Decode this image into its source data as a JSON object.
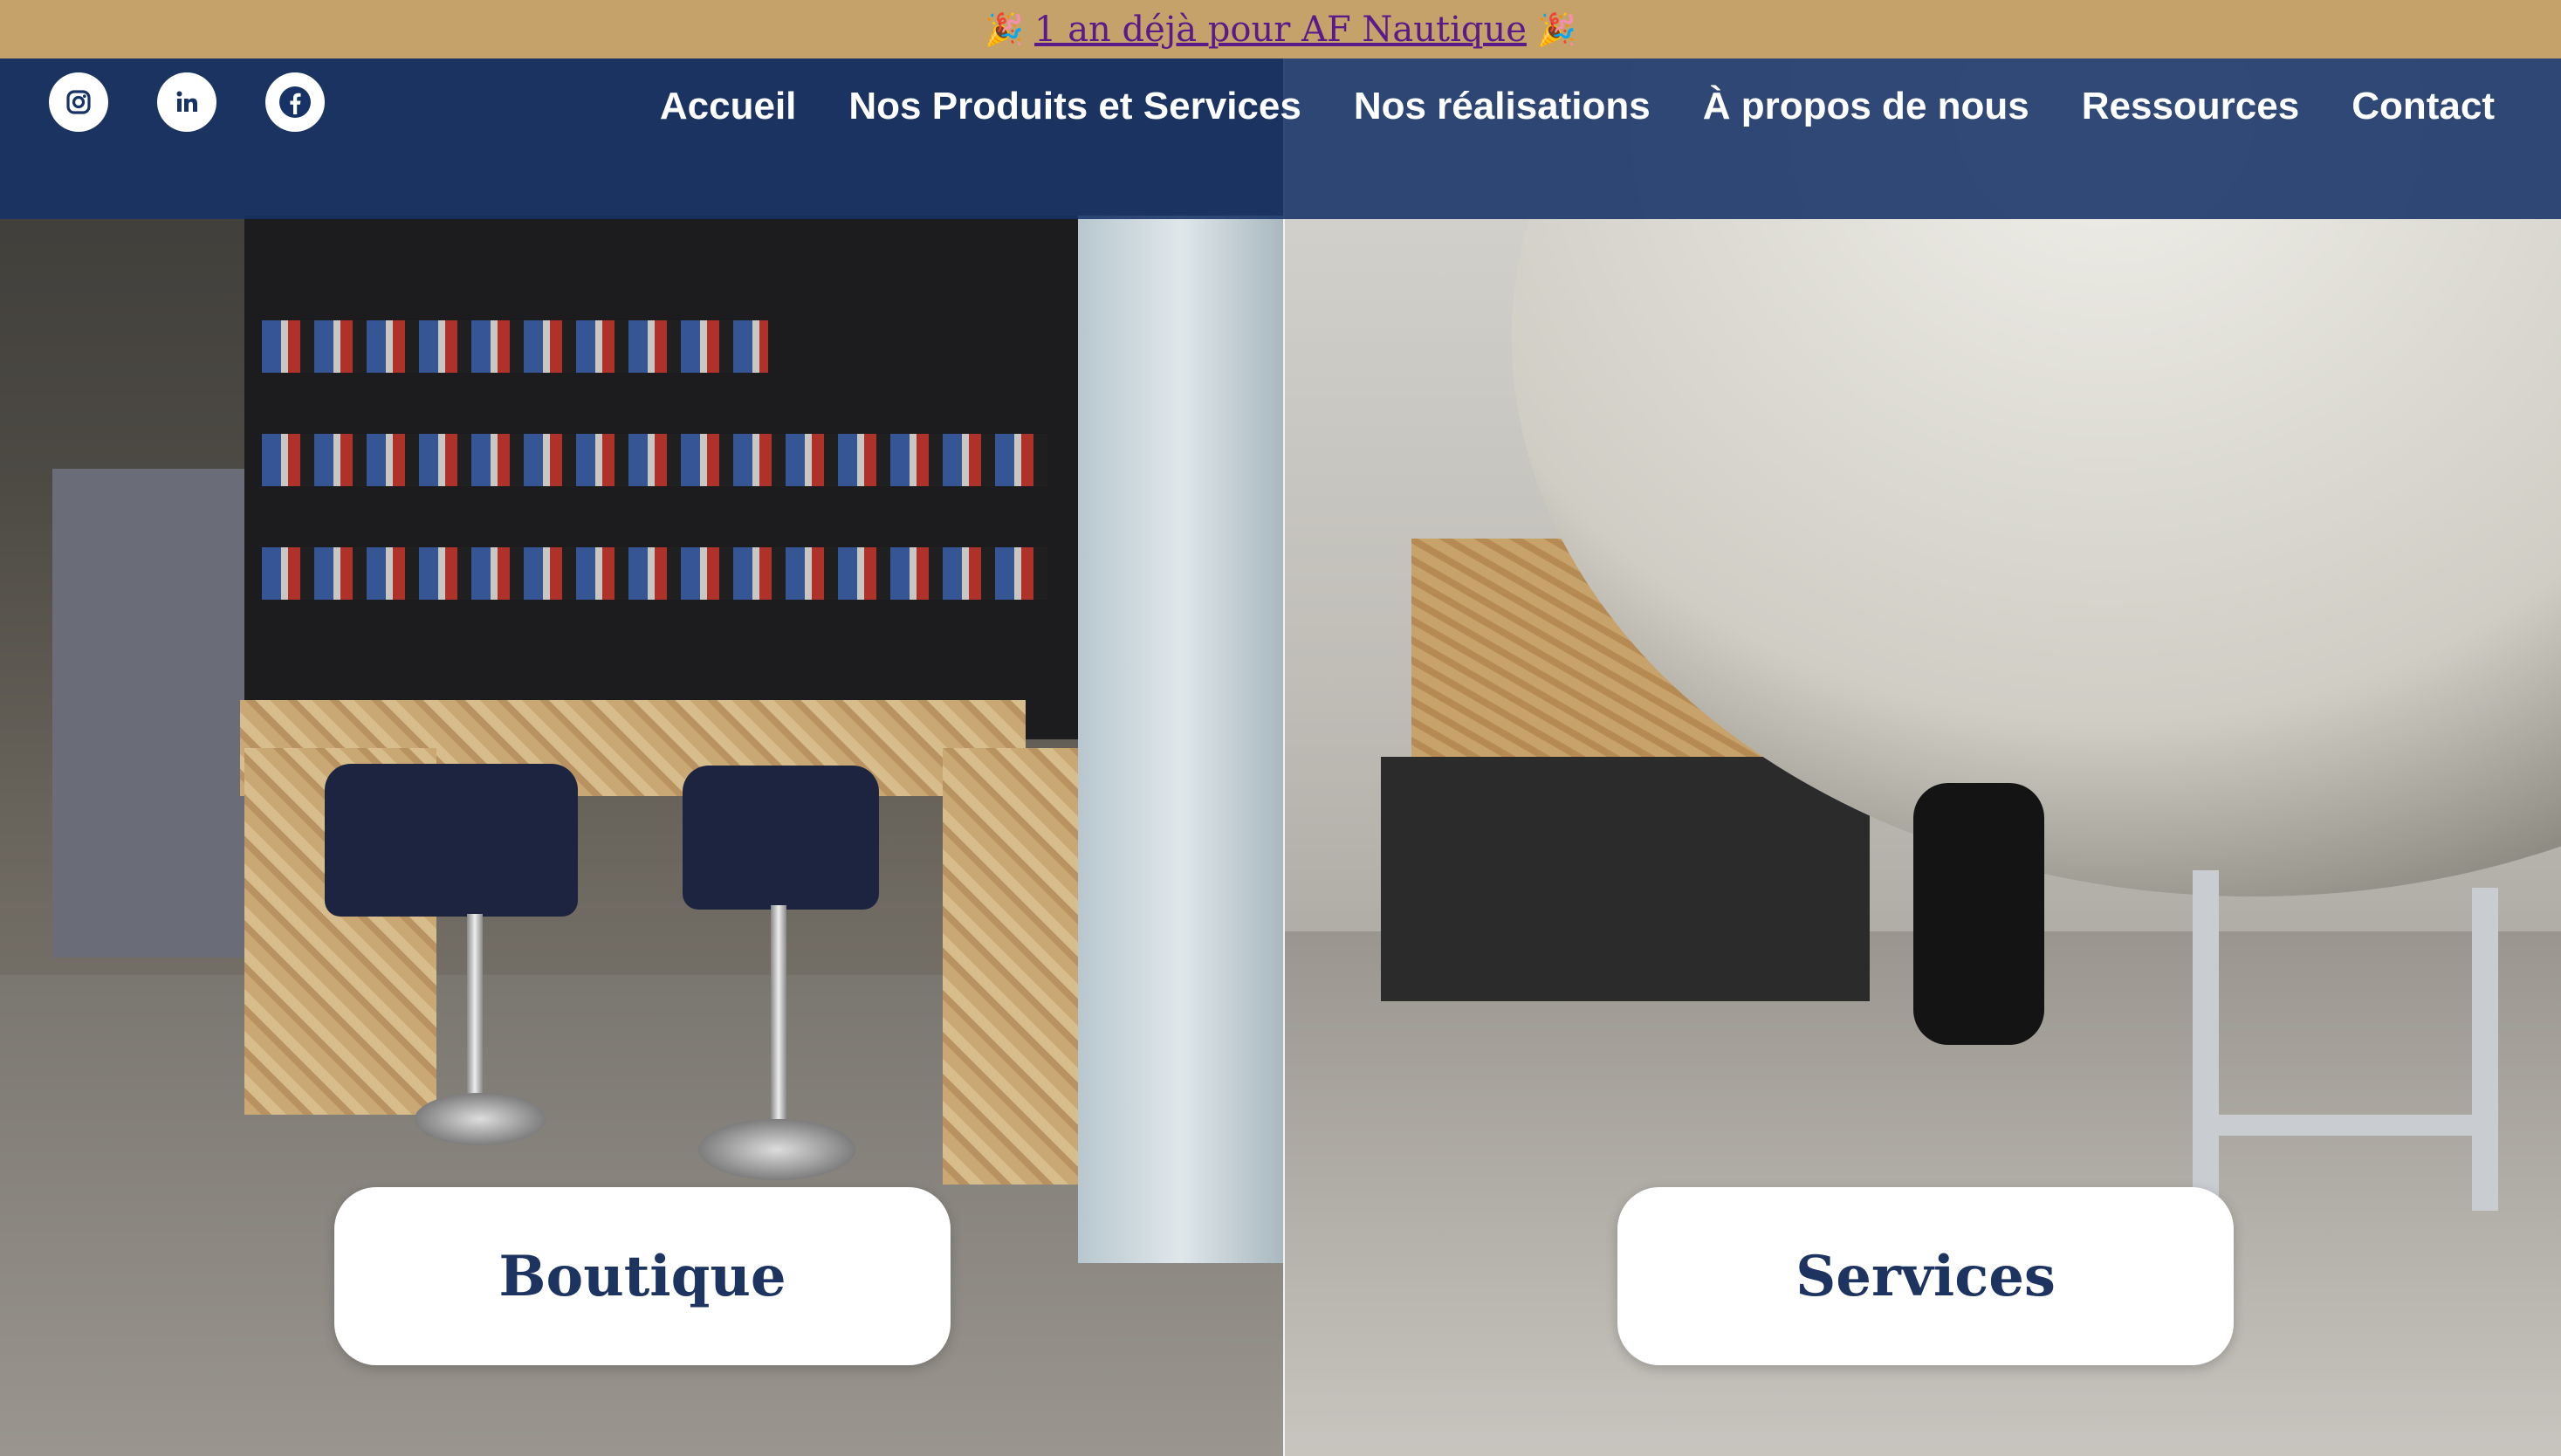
{
  "announcement": {
    "confetti_left": "🎉",
    "link_text": "1 an déjà pour AF Nautique",
    "confetti_right": "🎉"
  },
  "social": [
    {
      "icon": "instagram-icon"
    },
    {
      "icon": "linkedin-icon"
    },
    {
      "icon": "facebook-icon"
    }
  ],
  "nav": {
    "items": [
      {
        "label": "Accueil"
      },
      {
        "label": "Nos Produits et Services"
      },
      {
        "label": "Nos réalisations"
      },
      {
        "label": "À propos de nous"
      },
      {
        "label": "Ressources"
      },
      {
        "label": "Contact"
      }
    ]
  },
  "hero": {
    "left_button": "Boutique",
    "right_button": "Services"
  },
  "colors": {
    "announce_bg": "#c4a26a",
    "nav_bg": "#163266",
    "button_text": "#1d3461"
  }
}
